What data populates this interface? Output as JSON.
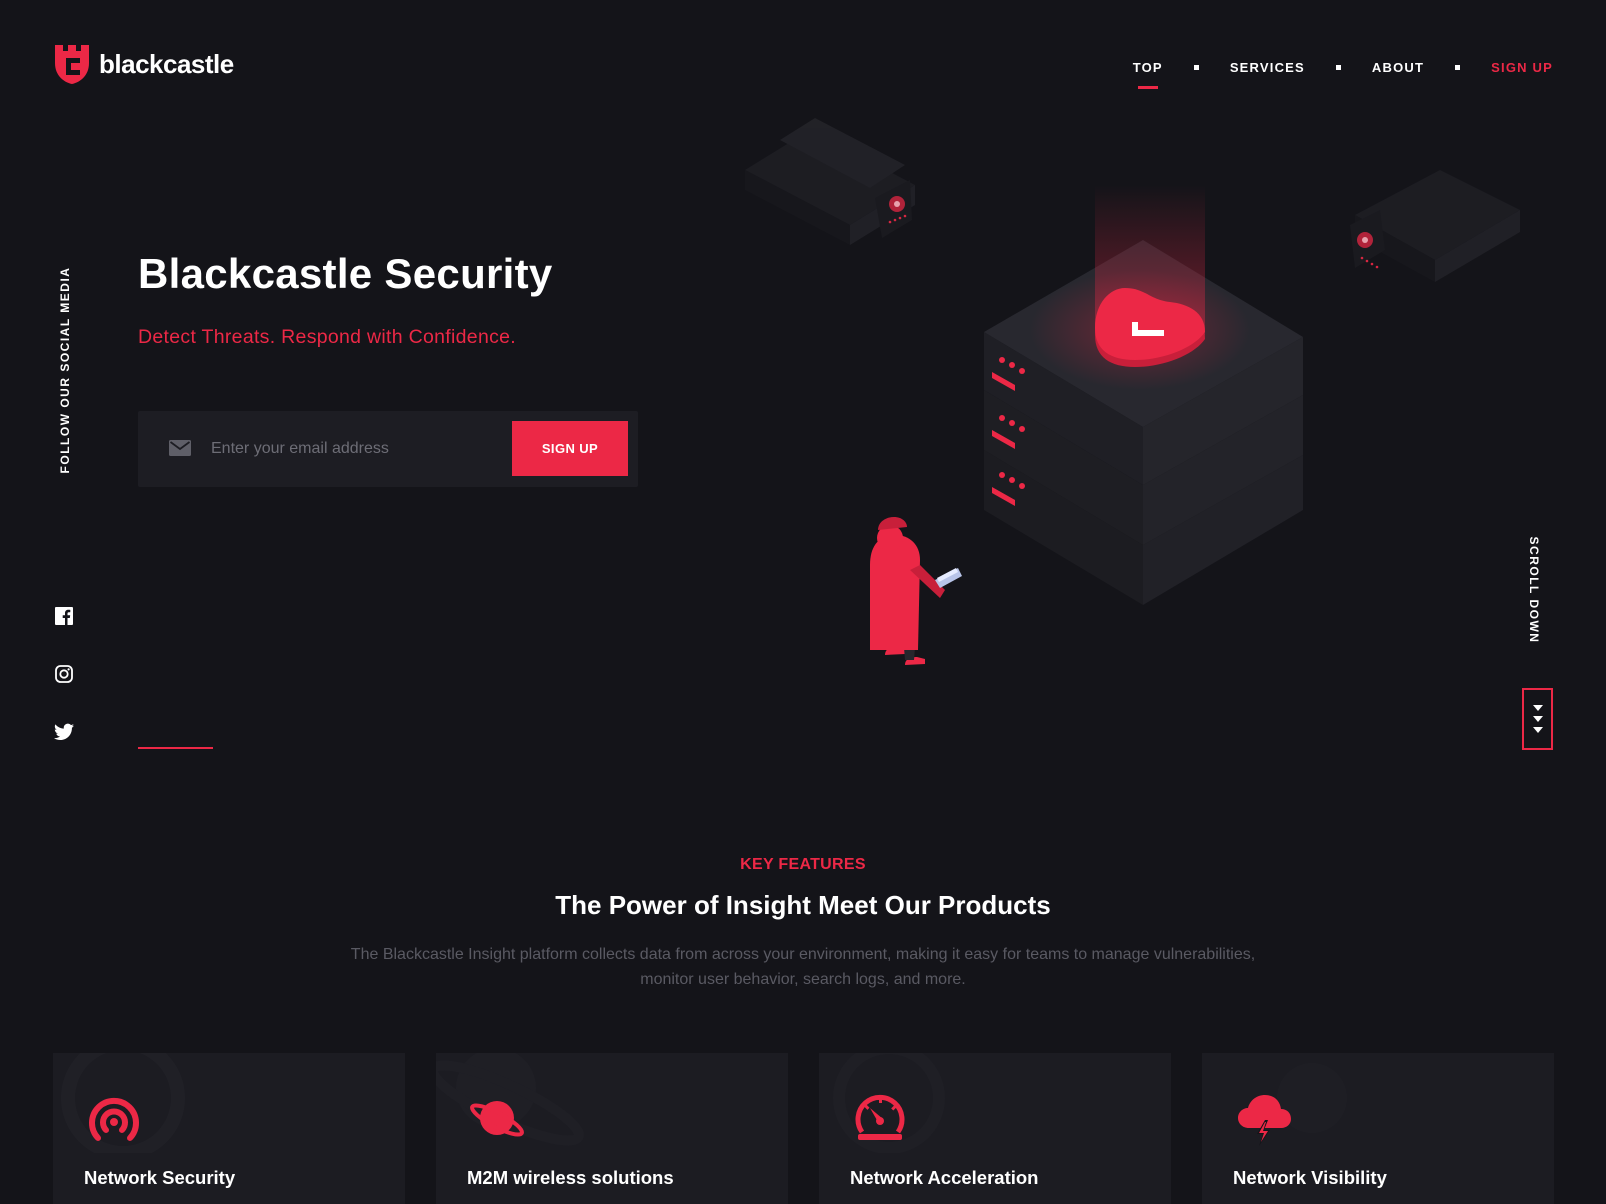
{
  "brand": {
    "name": "blackcastle",
    "accent": "#ec2846",
    "background": "#141419"
  },
  "nav": {
    "items": [
      {
        "label": "TOP",
        "active": true
      },
      {
        "label": "SERVICES"
      },
      {
        "label": "ABOUT"
      },
      {
        "label": "SIGN UP",
        "cta": true
      }
    ]
  },
  "social": {
    "label": "FOLLOW OUR SOCIAL MEDIA",
    "icons": [
      "facebook-icon",
      "instagram-icon",
      "twitter-icon"
    ]
  },
  "hero": {
    "title": "Blackcastle Security",
    "subtitle": "Detect Threats. Respond with Confidence.",
    "email_placeholder": "Enter your email address",
    "signup_label": "SIGN UP"
  },
  "scroll": {
    "label": "SCROLL DOWN"
  },
  "features": {
    "eyebrow": "KEY FEATURES",
    "title": "The Power of Insight Meet Our Products",
    "description": "The Blackcastle Insight platform collects data from across your environment, making it easy for teams to manage vulnerabilities, monitor user behavior, search logs, and more.",
    "cards": [
      {
        "title": "Network Security",
        "icon": "broadcast-icon"
      },
      {
        "title": "M2M wireless solutions",
        "icon": "planet-icon"
      },
      {
        "title": "Network Acceleration",
        "icon": "speedometer-icon"
      },
      {
        "title": "Network Visibility",
        "icon": "cloud-lightning-icon"
      }
    ]
  }
}
